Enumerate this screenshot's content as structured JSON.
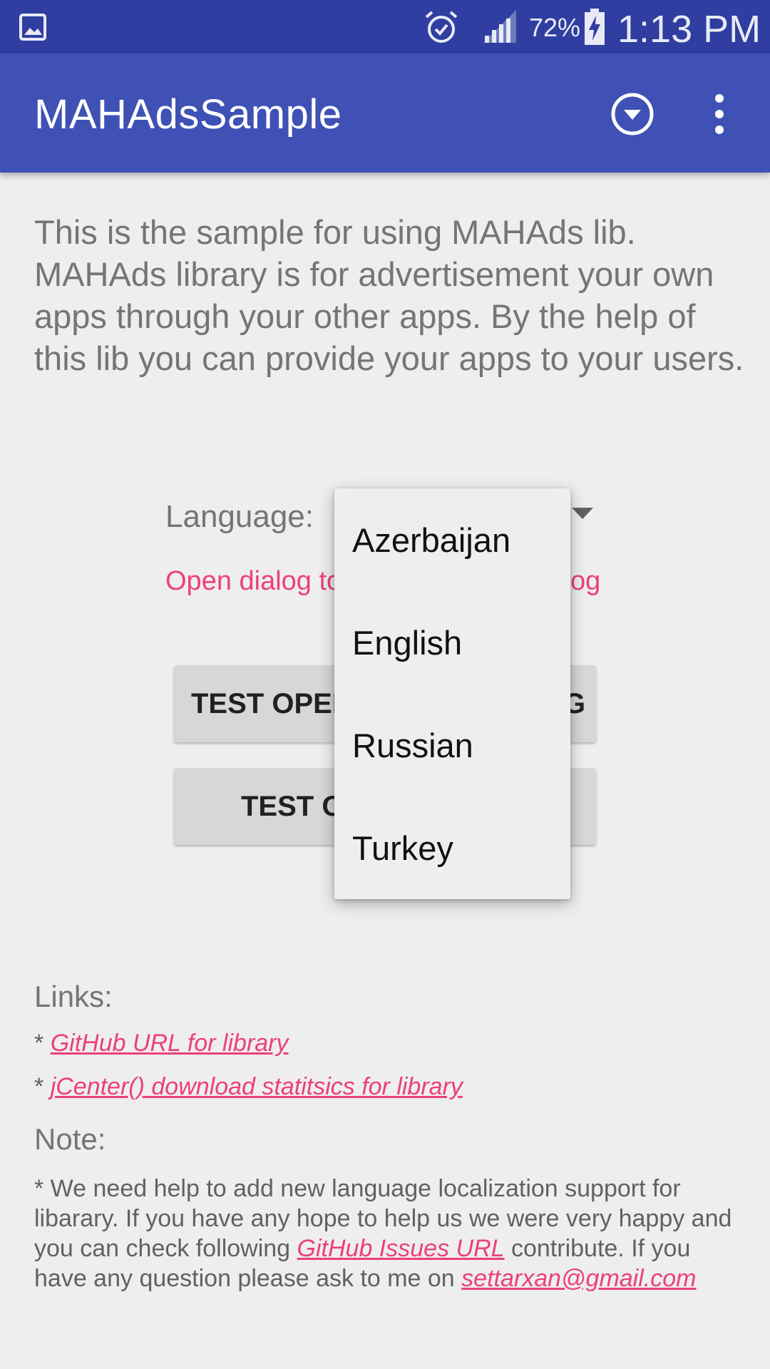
{
  "status_bar": {
    "battery_percent": "72%",
    "time": "1:13 PM",
    "icons": [
      "gallery-icon",
      "alarm-icon",
      "signal-icon",
      "battery-charging-icon"
    ]
  },
  "app_bar": {
    "title": "MAHAdsSample",
    "icons": [
      "dropdown-circle-icon",
      "overflow-menu-icon"
    ],
    "color": "#3f51b5"
  },
  "intro_text": "This is the sample for using MAHAds lib. MAHAds library is for advertisement your own apps through your other apps. By the help of this lib you can provide your apps to your users.",
  "language": {
    "label": "Language:",
    "options": [
      "Azerbaijan",
      "English",
      "Russian",
      "Turkey"
    ]
  },
  "open_dialog_link": "Open dialog to",
  "open_dialog_link_tail": "og",
  "buttons": {
    "test_open_visible": "TEST OPEN",
    "test_open_tail": "G",
    "test_second_visible": "TEST O"
  },
  "links": {
    "heading": "Links:",
    "bullet": "*",
    "github_label": "GitHub URL for library",
    "jcenter_label": "jCenter() download statitsics for library"
  },
  "note": {
    "heading": "Note:",
    "text_part1": "* We need help to add new language localization support for libarary. If you have any hope to help us we were very happy and you can check following ",
    "issues_link": "GitHub Issues URL",
    "text_part2": " contribute. If you have any question please ask to me on ",
    "email": "settarxan@gmail.com"
  },
  "colors": {
    "status_bar": "#2f3ea0",
    "accent": "#ec407a",
    "background": "#eeeeee"
  }
}
